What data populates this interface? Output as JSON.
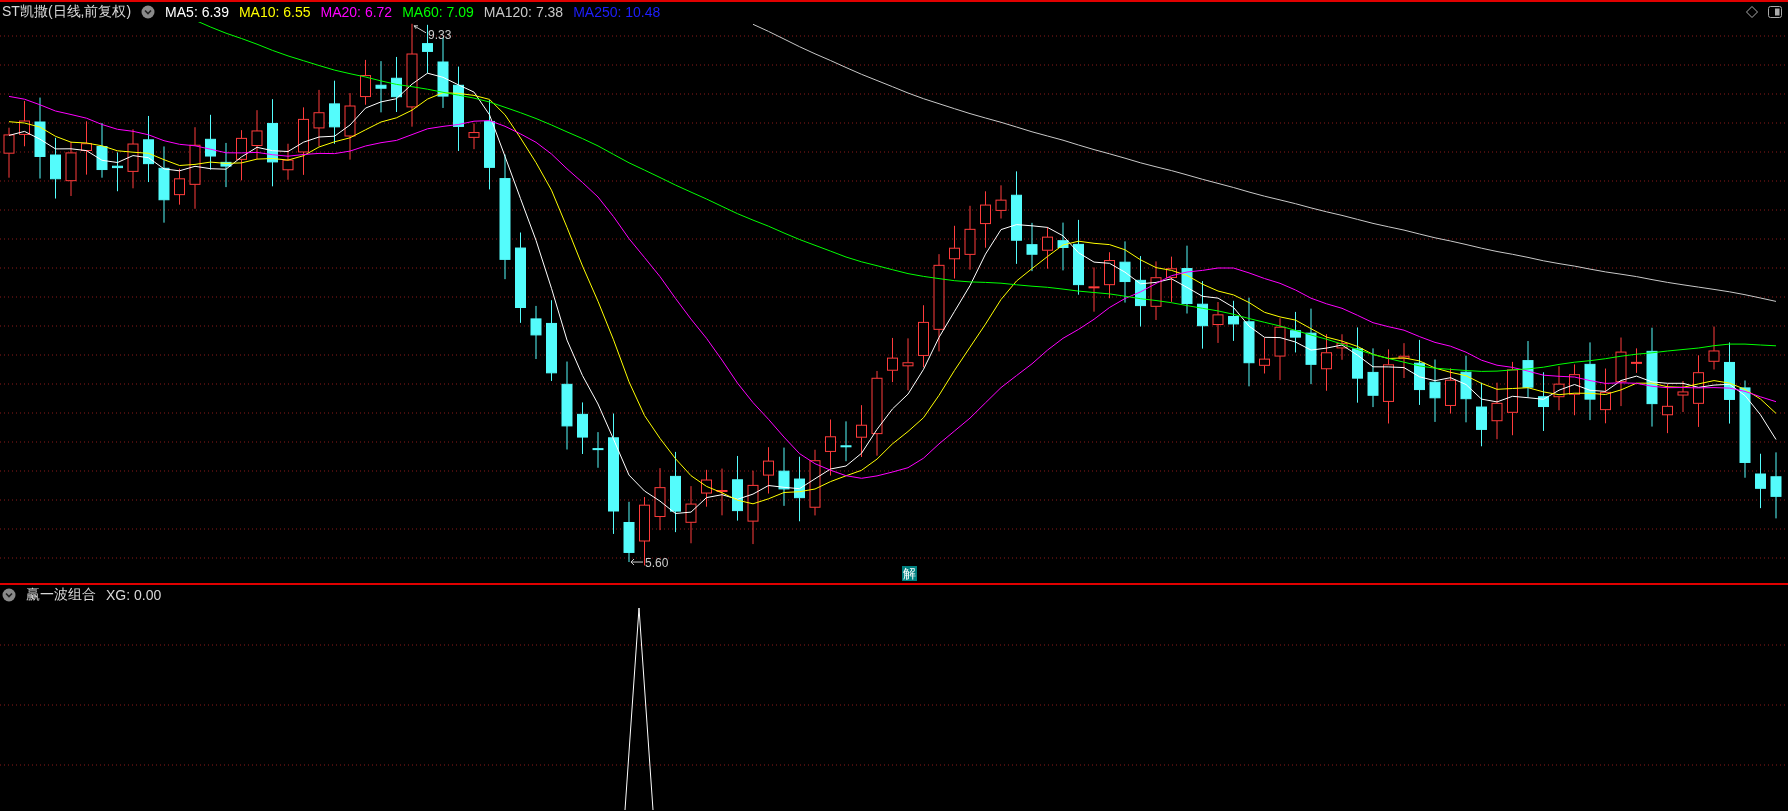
{
  "header": {
    "title": "ST凯撒(日线,前复权)",
    "indicators": [
      {
        "label": "MA5: 6.39",
        "color": "#ffffff"
      },
      {
        "label": "MA10: 6.55",
        "color": "#ffff00"
      },
      {
        "label": "MA20: 6.72",
        "color": "#ff00ff"
      },
      {
        "label": "MA60: 7.09",
        "color": "#00ff00"
      },
      {
        "label": "MA120: 7.38",
        "color": "#c8c8c8"
      },
      {
        "label": "MA250: 10.48",
        "color": "#1e1eff"
      }
    ]
  },
  "annotations": {
    "high": "9.33",
    "low": "5.60"
  },
  "badge": "解",
  "lower_panel": {
    "title": "赢一波组合",
    "value": "XG: 0.00"
  }
}
